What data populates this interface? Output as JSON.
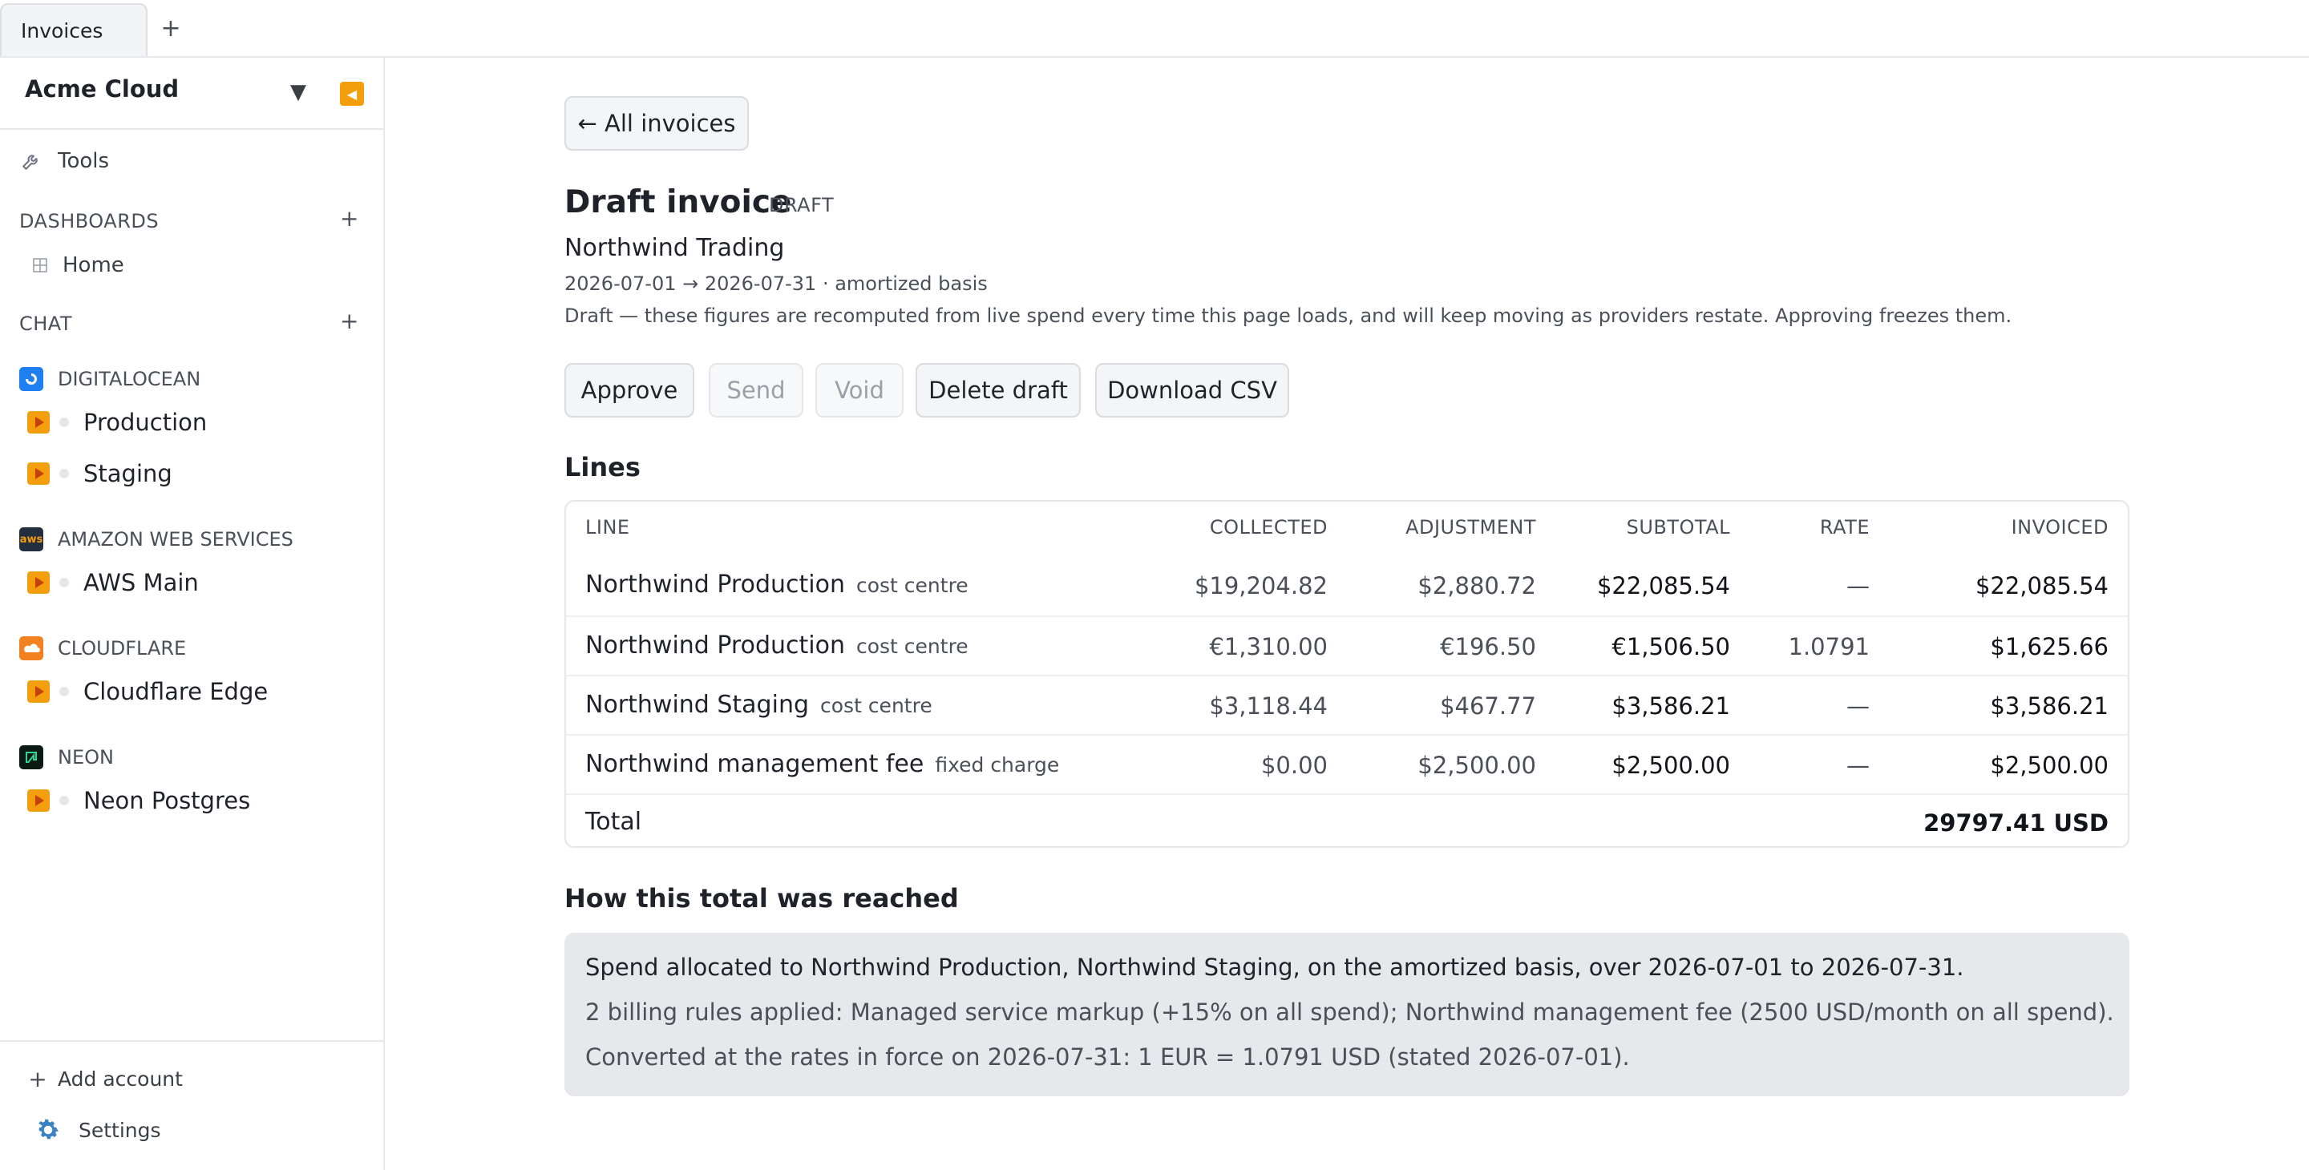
{
  "tabs": {
    "active": "Invoices",
    "add": "+"
  },
  "sidebar": {
    "workspace": "Acme Cloud",
    "caret": "▼",
    "collapse": "◀",
    "tools": "Tools",
    "dashboards_label": "DASHBOARDS",
    "home": "Home",
    "chat_label": "CHAT",
    "plus": "+",
    "providers": [
      {
        "name": "DIGITALOCEAN",
        "accounts": [
          "Production",
          "Staging"
        ]
      },
      {
        "name": "AMAZON WEB SERVICES",
        "logo_text": "aws",
        "accounts": [
          "AWS Main"
        ]
      },
      {
        "name": "CLOUDFLARE",
        "accounts": [
          "Cloudflare Edge"
        ]
      },
      {
        "name": "NEON",
        "accounts": [
          "Neon Postgres"
        ]
      }
    ],
    "add_account": "Add account",
    "settings": "Settings"
  },
  "main": {
    "back": "← All invoices",
    "title": "Draft invoice",
    "status": "DRAFT",
    "client": "Northwind Trading",
    "period": "2026-07-01 → 2026-07-31 · amortized basis",
    "note": "Draft — these figures are recomputed from live spend every time this page loads, and will keep moving as providers restate. Approving freezes them.",
    "actions": {
      "approve": "Approve",
      "send": "Send",
      "void": "Void",
      "delete": "Delete draft",
      "csv": "Download CSV"
    },
    "lines_heading": "Lines",
    "columns": [
      "LINE",
      "COLLECTED",
      "ADJUSTMENT",
      "SUBTOTAL",
      "RATE",
      "INVOICED"
    ],
    "lines": [
      {
        "name": "Northwind Production",
        "kind": "cost centre",
        "collected": "$19,204.82",
        "adjustment": "$2,880.72",
        "subtotal": "$22,085.54",
        "rate": "—",
        "invoiced": "$22,085.54"
      },
      {
        "name": "Northwind Production",
        "kind": "cost centre",
        "collected": "€1,310.00",
        "adjustment": "€196.50",
        "subtotal": "€1,506.50",
        "rate": "1.0791",
        "invoiced": "$1,625.66"
      },
      {
        "name": "Northwind Staging",
        "kind": "cost centre",
        "collected": "$3,118.44",
        "adjustment": "$467.77",
        "subtotal": "$3,586.21",
        "rate": "—",
        "invoiced": "$3,586.21"
      },
      {
        "name": "Northwind management fee",
        "kind": "fixed charge",
        "collected": "$0.00",
        "adjustment": "$2,500.00",
        "subtotal": "$2,500.00",
        "rate": "—",
        "invoiced": "$2,500.00"
      }
    ],
    "total_label": "Total",
    "total_value": "29797.41 USD",
    "how_heading": "How this total was reached",
    "how": [
      "Spend allocated to Northwind Production, Northwind Staging, on the amortized basis, over 2026-07-01 to 2026-07-31.",
      "2 billing rules applied: Managed service markup (+15% on all spend); Northwind management fee (2500 USD/month on all spend).",
      "Converted at the rates in force on 2026-07-31: 1 EUR = 1.0791 USD (stated 2026-07-01)."
    ]
  },
  "colors": {
    "accent": "#f59e0b",
    "digitalocean": "#1e7ff0",
    "aws": "#232f3e",
    "cloudflare": "#f48120",
    "neon": "#0b1a12"
  }
}
